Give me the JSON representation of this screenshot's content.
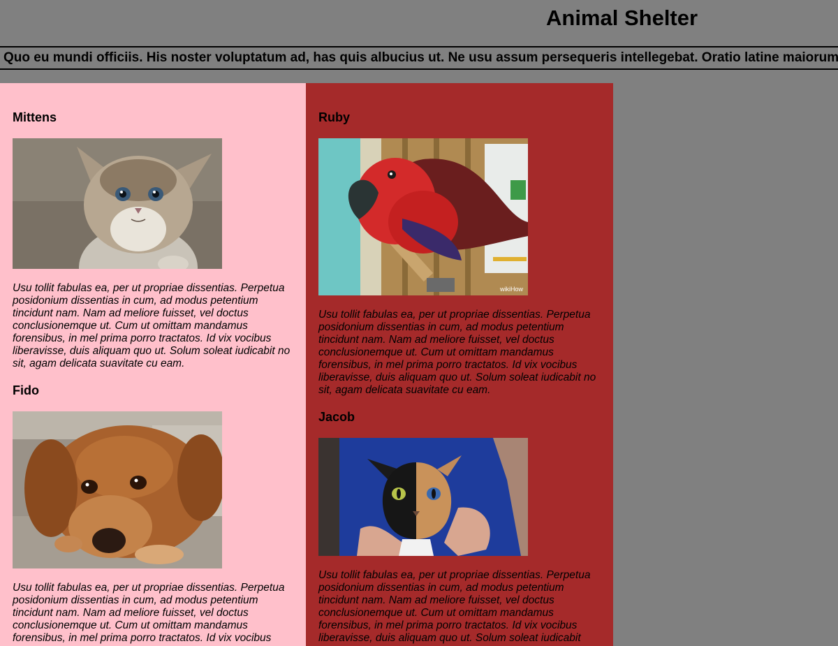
{
  "header": {
    "title": "Animal Shelter"
  },
  "marquee": {
    "text": "Quo eu mundi officiis. His noster voluptatum ad, has quis albucius ut. Ne usu assum persequeris intellegebat. Oratio latine maiorum"
  },
  "animals": [
    {
      "name": "Mittens",
      "description": "Usu tollit fabulas ea, per ut propriae dissentias. Perpetua posidonium dissentias in cum, ad modus petentium tincidunt nam. Nam ad meliore fuisset, vel doctus conclusionemque ut. Cum ut omittam mandamus forensibus, in mel prima porro tractatos. Id vix vocibus liberavisse, duis aliquam quo ut. Solum soleat iudicabit no sit, agam delicata suavitate cu eam.",
      "photo_icon": "kitten-photo"
    },
    {
      "name": "Fido",
      "description": "Usu tollit fabulas ea, per ut propriae dissentias. Perpetua posidonium dissentias in cum, ad modus petentium tincidunt nam. Nam ad meliore fuisset, vel doctus conclusionemque ut. Cum ut omittam mandamus forensibus, in mel prima porro tractatos. Id vix vocibus",
      "photo_icon": "dog-photo"
    },
    {
      "name": "Ruby",
      "description": "Usu tollit fabulas ea, per ut propriae dissentias. Perpetua posidonium dissentias in cum, ad modus petentium tincidunt nam. Nam ad meliore fuisset, vel doctus conclusionemque ut. Cum ut omittam mandamus forensibus, in mel prima porro tractatos. Id vix vocibus liberavisse, duis aliquam quo ut. Solum soleat iudicabit no sit, agam delicata suavitate cu eam.",
      "photo_icon": "parrot-photo",
      "photo_watermark": "wikiHow"
    },
    {
      "name": "Jacob",
      "description": "Usu tollit fabulas ea, per ut propriae dissentias. Perpetua posidonium dissentias in cum, ad modus petentium tincidunt nam. Nam ad meliore fuisset, vel doctus conclusionemque ut. Cum ut omittam mandamus forensibus, in mel prima porro tractatos. Id vix vocibus liberavisse, duis aliquam quo ut. Solum soleat iudicabit",
      "photo_icon": "two-face-cat-photo"
    }
  ],
  "colors": {
    "page_bg": "#808080",
    "left_column_bg": "#ffc0cb",
    "right_column_bg": "#a52a2a"
  }
}
